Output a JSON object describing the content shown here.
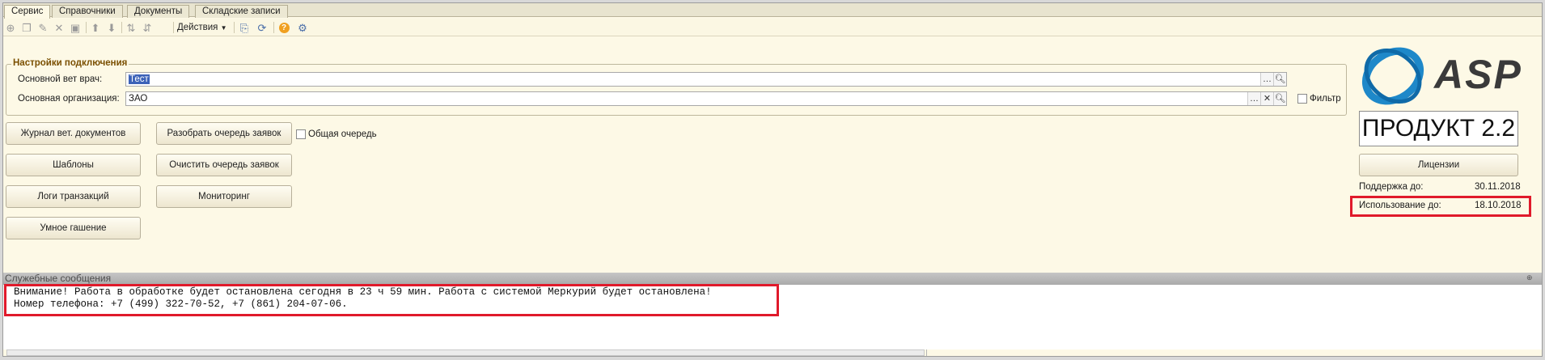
{
  "tabs": [
    {
      "label": "Сервис",
      "active": true
    },
    {
      "label": "Справочники",
      "active": false
    },
    {
      "label": "Документы",
      "active": false
    },
    {
      "label": "Складские записи",
      "active": false
    }
  ],
  "toolbar": {
    "actions_label": "Действия",
    "icons": [
      "add-icon",
      "copy-icon",
      "edit-icon",
      "delete-icon",
      "save-icon",
      "move-up-icon",
      "move-down-icon",
      "sort-asc-icon",
      "sort-desc-icon",
      "export-icon",
      "refresh-icon",
      "help-icon",
      "settings-icon"
    ]
  },
  "connection_group": {
    "title": "Настройки подключения",
    "vet_label": "Основной вет врач:",
    "vet_value": "Тест",
    "org_label": "Основная организация:",
    "org_value": "ЗАО",
    "filter_label": "Фильтр",
    "filter_checked": false
  },
  "buttons": {
    "journal": "Журнал вет. документов",
    "templates": "Шаблоны",
    "transaction_logs": "Логи транзакций",
    "smart_quenching": "Умное гашение",
    "parse_queue": "Разобрать очередь заявок",
    "clear_queue": "Очистить очередь заявок",
    "monitoring": "Мониторинг"
  },
  "common_queue": {
    "label": "Общая очередь",
    "checked": false
  },
  "right_panel": {
    "brand": "ASP",
    "product": "ПРОДУКТ 2.2",
    "licenses_button": "Лицензии",
    "support_label": "Поддержка до:",
    "support_date": "30.11.2018",
    "usage_label": "Использование до:",
    "usage_date": "18.10.2018"
  },
  "messages": {
    "header": "Служебные сообщения",
    "lines": [
      "Внимание! Работа в обработке будет остановлена сегодня в 23 ч 59 мин. Работа с системой Меркурий будет остановлена!",
      "Номер телефона: +7 (499) 322-70-52, +7 (861) 204-07-06."
    ]
  },
  "colors": {
    "highlight": "#e01a2b",
    "logo_blue": "#1e88c9",
    "background": "#fdf9e6",
    "selection": "#3c62b8"
  }
}
